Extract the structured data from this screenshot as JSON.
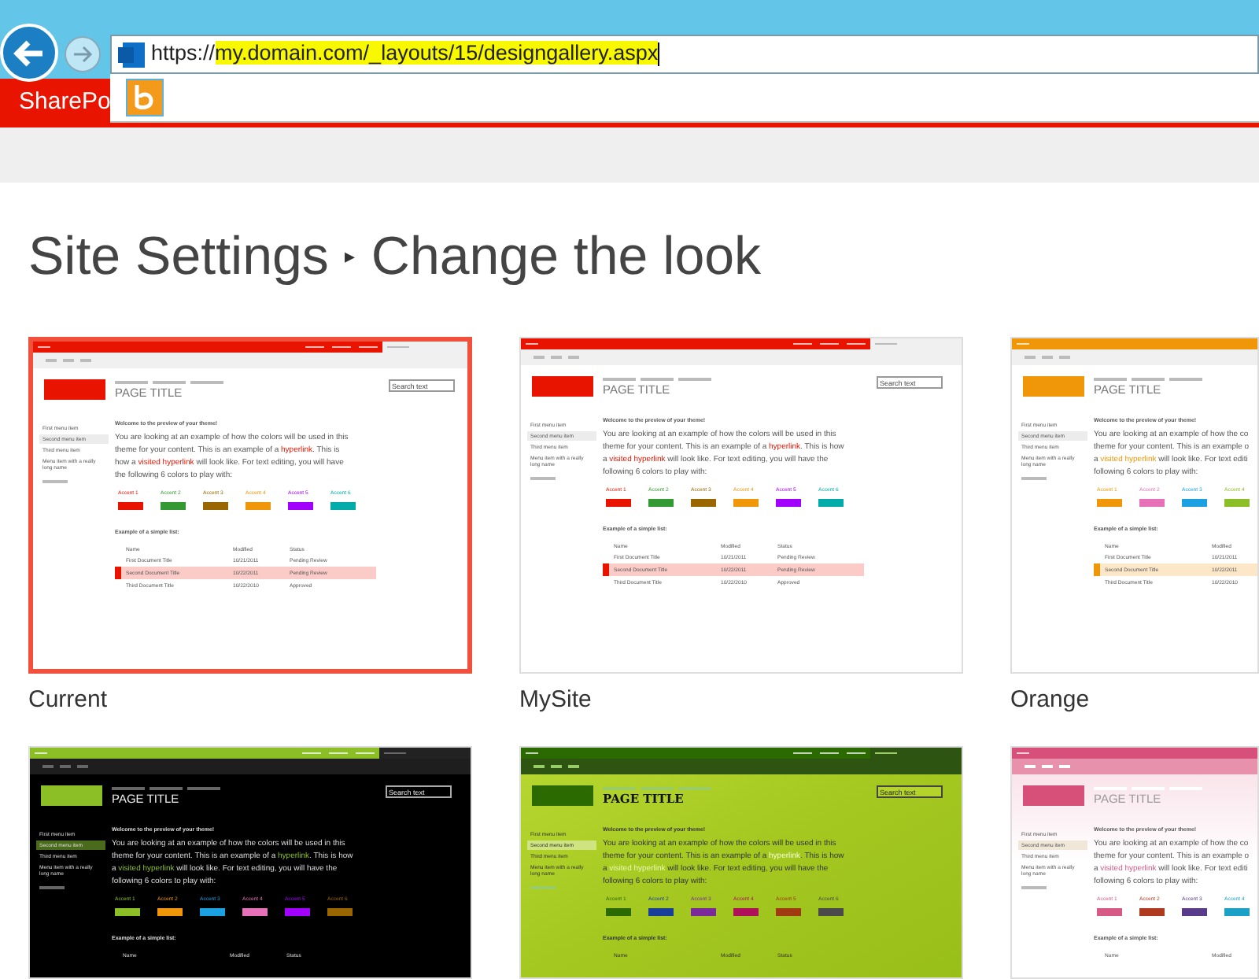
{
  "browser": {
    "address": [
      {
        "text": "https://",
        "highlighted": false
      },
      {
        "text": "my.domain.com/_layouts/15/designgallery.aspx",
        "highlighted": true
      }
    ],
    "suite_bar": "SharePo"
  },
  "heading": {
    "parts": [
      "Site Settings",
      "▸",
      "Change the look"
    ]
  },
  "themes": [
    {
      "caption": "Current",
      "selected": true,
      "kind": "light",
      "color": "#e81400",
      "search": "Search text",
      "title": "PAGE TITLE",
      "menu": [
        {
          "text": "First menu item",
          "selected": false
        },
        {
          "text": "Second menu item",
          "selected": true
        },
        {
          "text": "Third menu item",
          "selected": false
        },
        {
          "text": "Menu item with a really long name",
          "selected": false
        }
      ],
      "welcome": "Welcome to the preview of your theme!",
      "paragraph": [
        [
          {
            "kind": "plain",
            "text": "You are looking at an example of how the colors will be used in this"
          }
        ],
        [
          {
            "kind": "plain",
            "text": "theme for your content. This is an example of a "
          },
          {
            "kind": "link",
            "text": "hyperlink"
          },
          {
            "kind": "plain",
            "text": ". This is"
          }
        ],
        [
          {
            "kind": "plain",
            "text": "how a "
          },
          {
            "kind": "visited",
            "text": "visited hyperlink"
          },
          {
            "kind": "plain",
            "text": " will look like. For text editing, you will have"
          }
        ],
        [
          {
            "kind": "plain",
            "text": "the following 6 colors to play with:"
          }
        ]
      ],
      "accents": [
        {
          "label": "Accent 1",
          "color": "#e81400"
        },
        {
          "label": "Accent 2",
          "color": "#339933"
        },
        {
          "label": "Accent 3",
          "color": "#996600"
        },
        {
          "label": "Accent 4",
          "color": "#f09609"
        },
        {
          "label": "Accent 5",
          "color": "#a200ff"
        },
        {
          "label": "Accent 6",
          "color": "#00aba9"
        }
      ],
      "list_title": "Example of a simple list:",
      "columns": [
        "Name",
        "Modified",
        "Status"
      ],
      "rows": [
        {
          "selected": false,
          "cells": [
            "First Document Title",
            "10/21/2011",
            "Pending Review"
          ]
        },
        {
          "selected": true,
          "cells": [
            "Second Document Title",
            "10/22/2011",
            "Pending Review"
          ]
        },
        {
          "selected": false,
          "cells": [
            "Third Document Title",
            "10/22/2010",
            "Approved"
          ]
        }
      ]
    },
    {
      "caption": "MySite",
      "selected": false,
      "kind": "light",
      "color": "#e81400",
      "search": "Search text",
      "title": "PAGE TITLE",
      "menu": [
        {
          "text": "First menu item",
          "selected": false
        },
        {
          "text": "Second menu item",
          "selected": true
        },
        {
          "text": "Third menu item",
          "selected": false
        },
        {
          "text": "Menu item with a really long name",
          "selected": false
        }
      ],
      "welcome": "Welcome to the preview of your theme!",
      "paragraph": [
        [
          {
            "kind": "plain",
            "text": "You are looking at an example of how the colors will be used in this"
          }
        ],
        [
          {
            "kind": "plain",
            "text": "theme for your content. This is an example of a "
          },
          {
            "kind": "link",
            "text": "hyperlink"
          },
          {
            "kind": "plain",
            "text": ". This is how"
          }
        ],
        [
          {
            "kind": "plain",
            "text": "a "
          },
          {
            "kind": "visited",
            "text": "visited hyperlink"
          },
          {
            "kind": "plain",
            "text": " will look like. For text editing, you will have the"
          }
        ],
        [
          {
            "kind": "plain",
            "text": "following 6 colors to play with:"
          }
        ]
      ],
      "accents": [
        {
          "label": "Accent 1",
          "color": "#e81400"
        },
        {
          "label": "Accent 2",
          "color": "#339933"
        },
        {
          "label": "Accent 3",
          "color": "#996600"
        },
        {
          "label": "Accent 4",
          "color": "#f09609"
        },
        {
          "label": "Accent 5",
          "color": "#a200ff"
        },
        {
          "label": "Accent 6",
          "color": "#00aba9"
        }
      ],
      "list_title": "Example of a simple list:",
      "columns": [
        "Name",
        "Modified",
        "Status"
      ],
      "rows": [
        {
          "selected": false,
          "cells": [
            "First Document Title",
            "10/21/2011",
            "Pending Review"
          ]
        },
        {
          "selected": true,
          "cells": [
            "Second Document Title",
            "10/22/2011",
            "Pending Review"
          ]
        },
        {
          "selected": false,
          "cells": [
            "Third Document Title",
            "10/22/2010",
            "Approved"
          ]
        }
      ]
    },
    {
      "caption": "Orange",
      "selected": false,
      "kind": "light",
      "color": "#f09609",
      "title": "PAGE TITLE",
      "menu": [
        {
          "text": "First menu item",
          "selected": false
        },
        {
          "text": "Second menu item",
          "selected": true
        },
        {
          "text": "Third menu item",
          "selected": false
        },
        {
          "text": "Menu item with a really long name",
          "selected": false
        }
      ],
      "welcome": "Welcome to the preview of your theme!",
      "paragraph": [
        [
          {
            "kind": "plain",
            "text": "You are looking at an example of how the co"
          }
        ],
        [
          {
            "kind": "plain",
            "text": "theme for your content. This is an example o"
          }
        ],
        [
          {
            "kind": "plain",
            "text": "a "
          },
          {
            "kind": "visited",
            "text": "visited hyperlink"
          },
          {
            "kind": "plain",
            "text": " will look like. For text editi"
          }
        ],
        [
          {
            "kind": "plain",
            "text": "following 6 colors to play with:"
          }
        ]
      ],
      "accents": [
        {
          "label": "Accent 1",
          "color": "#f09609"
        },
        {
          "label": "Accent 2",
          "color": "#e671b8"
        },
        {
          "label": "Accent 3",
          "color": "#1ba1e2"
        },
        {
          "label": "Accent 4",
          "color": "#8cbf26"
        }
      ],
      "list_title": "Example of a simple list:",
      "columns": [
        "Name",
        "Modified"
      ],
      "rows": [
        {
          "selected": false,
          "cells": [
            "First Document Title",
            "10/21/2011"
          ]
        },
        {
          "selected": true,
          "cells": [
            "Second Document Title",
            "10/22/2011"
          ]
        },
        {
          "selected": false,
          "cells": [
            "Third Document Title",
            "10/22/2010"
          ]
        }
      ]
    },
    {
      "selected": false,
      "kind": "dark",
      "color": "#8cbf26",
      "search": "Search text",
      "title": "PAGE TITLE",
      "menu": [
        {
          "text": "First menu item",
          "selected": false
        },
        {
          "text": "Second menu item",
          "selected": true
        },
        {
          "text": "Third menu item",
          "selected": false
        },
        {
          "text": "Menu item with a really long name",
          "selected": false
        }
      ],
      "welcome": "Welcome to the preview of your theme!",
      "paragraph": [
        [
          {
            "kind": "plain",
            "text": "You are looking at an example of how the colors will be used in this"
          }
        ],
        [
          {
            "kind": "plain",
            "text": "theme for your content. This is an example of a "
          },
          {
            "kind": "link",
            "text": "hyperlink"
          },
          {
            "kind": "plain",
            "text": ". This is how"
          }
        ],
        [
          {
            "kind": "plain",
            "text": "a "
          },
          {
            "kind": "visited",
            "text": "visited hyperlink"
          },
          {
            "kind": "plain",
            "text": " will look like. For text editing, you will have the"
          }
        ],
        [
          {
            "kind": "plain",
            "text": "following 6 colors to play with:"
          }
        ]
      ],
      "accents": [
        {
          "label": "Accent 1",
          "color": "#8cbf26"
        },
        {
          "label": "Accent 2",
          "color": "#f09609"
        },
        {
          "label": "Accent 3",
          "color": "#1ba1e2"
        },
        {
          "label": "Accent 4",
          "color": "#e671b8"
        },
        {
          "label": "Accent 5",
          "color": "#a200ff"
        },
        {
          "label": "Accent 6",
          "color": "#996600"
        }
      ],
      "list_title": "Example of a simple list:",
      "columns": [
        "Name",
        "Modified",
        "Status"
      ]
    },
    {
      "selected": false,
      "kind": "photo_green",
      "color": "#2a6a00",
      "search": "Search text",
      "title": "PAGE TITLE",
      "menu": [
        {
          "text": "First menu item",
          "selected": false
        },
        {
          "text": "Second menu item",
          "selected": true
        },
        {
          "text": "Third menu item",
          "selected": false
        },
        {
          "text": "Menu item with a really long name",
          "selected": false
        }
      ],
      "welcome": "Welcome to the preview of your theme!",
      "paragraph": [
        [
          {
            "kind": "plain",
            "text": "You are looking at an example of how the colors will be used in this"
          }
        ],
        [
          {
            "kind": "plain",
            "text": "theme for your content. This is an example of a "
          },
          {
            "kind": "link",
            "text": "hyperlink"
          },
          {
            "kind": "plain",
            "text": ". This is how"
          }
        ],
        [
          {
            "kind": "plain",
            "text": "a "
          },
          {
            "kind": "visited",
            "text": "visited hyperlink"
          },
          {
            "kind": "plain",
            "text": " will look like. For text editing, you will have the"
          }
        ],
        [
          {
            "kind": "plain",
            "text": "following 6 colors to play with:"
          }
        ]
      ],
      "accents": [
        {
          "label": "Accent 1",
          "color": "#2a6a00"
        },
        {
          "label": "Accent 2",
          "color": "#1a3f9a"
        },
        {
          "label": "Accent 3",
          "color": "#7a2a9a"
        },
        {
          "label": "Accent 4",
          "color": "#b0105a"
        },
        {
          "label": "Accent 5",
          "color": "#a03a10"
        },
        {
          "label": "Accent 6",
          "color": "#4a4a4a"
        }
      ],
      "list_title": "Example of a simple list:",
      "columns": [
        "Name",
        "Modified",
        "Status"
      ]
    },
    {
      "selected": false,
      "kind": "photo_pink",
      "color": "#d6507a",
      "title": "PAGE TITLE",
      "menu": [
        {
          "text": "First menu item",
          "selected": false
        },
        {
          "text": "Second menu item",
          "selected": true
        },
        {
          "text": "Third menu item",
          "selected": false
        },
        {
          "text": "Menu item with a really long name",
          "selected": false
        }
      ],
      "welcome": "Welcome to the preview of your theme!",
      "paragraph": [
        [
          {
            "kind": "plain",
            "text": "You are looking at an example of how the co"
          }
        ],
        [
          {
            "kind": "plain",
            "text": "theme for your content. This is an example o"
          }
        ],
        [
          {
            "kind": "plain",
            "text": "a "
          },
          {
            "kind": "visited",
            "text": "visited hyperlink"
          },
          {
            "kind": "plain",
            "text": " will look like. For text editi"
          }
        ],
        [
          {
            "kind": "plain",
            "text": "following 6 colors to play with:"
          }
        ]
      ],
      "accents": [
        {
          "label": "Accent 1",
          "color": "#d65a85"
        },
        {
          "label": "Accent 2",
          "color": "#b03a20"
        },
        {
          "label": "Accent 3",
          "color": "#5a3a8a"
        },
        {
          "label": "Accent 4",
          "color": "#1ba1c8"
        }
      ],
      "list_title": "Example of a simple list:",
      "columns": [
        "Name",
        "Modified"
      ]
    }
  ]
}
